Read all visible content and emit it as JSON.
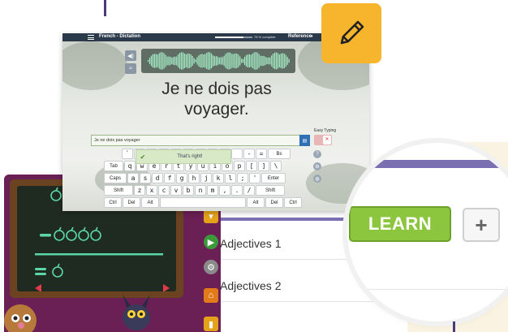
{
  "dictation": {
    "menu_label": "",
    "title": "French - Dictation",
    "progress_percent": 75,
    "progress_label": "75 % complete",
    "reference_label": "Reference",
    "reference_caret": "▾",
    "sentence": "Je ne dois pas voyager.",
    "input_value": "Je ne dois pas voyager",
    "submit_icon": "keyboard-icon",
    "easy_typing_label": "Easy Typing",
    "toast_message": "That's right!",
    "keyboard": {
      "row1": [
        "`",
        "1",
        "2",
        "3",
        "4",
        "",
        "",
        "",
        "",
        "",
        "-",
        "=",
        "Bs"
      ],
      "row2": [
        "Tab",
        "q",
        "w",
        "e",
        "r",
        "t",
        "y",
        "u",
        "i",
        "o",
        "p",
        "[",
        "]",
        "\\"
      ],
      "row3": [
        "Caps",
        "a",
        "s",
        "d",
        "f",
        "g",
        "h",
        "j",
        "k",
        "l",
        ";",
        "'",
        "Enter"
      ],
      "row4": [
        "Shift",
        "z",
        "x",
        "c",
        "v",
        "b",
        "n",
        "m",
        ",",
        ".",
        "/",
        "Shift"
      ],
      "row5": [
        "Ctrl",
        "Del",
        "Alt",
        "",
        "Alt",
        "Del",
        "Ctrl"
      ]
    }
  },
  "lessons": {
    "items": [
      "Adjectives 1",
      "Adjectives 2"
    ]
  },
  "magnifier": {
    "learn_label": "LEARN",
    "plus_label": "+"
  },
  "colors": {
    "accent_purple": "#7a6fb0",
    "learn_green": "#8cc63f",
    "badge_orange": "#f6b52c",
    "game_bg": "#6a1f55",
    "chalk": "#5cd8a8"
  }
}
